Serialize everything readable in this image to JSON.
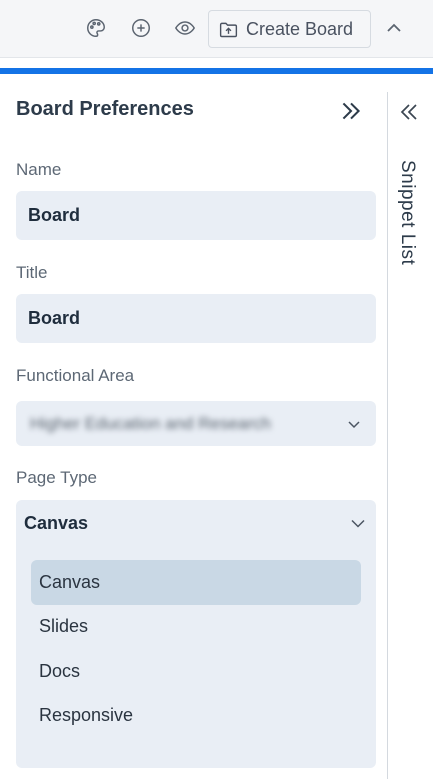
{
  "toolbar": {
    "icons": [
      "palette-icon",
      "add-circle-icon",
      "eye-icon"
    ],
    "create_board_label": "Create Board"
  },
  "panel": {
    "title": "Board Preferences",
    "name_label": "Name",
    "name_value": "Board",
    "title_label": "Title",
    "title_value": "Board",
    "functional_area_label": "Functional Area",
    "functional_area_value": "Higher Education and Research",
    "page_type_label": "Page Type",
    "page_type_value": "Canvas",
    "page_type_options": [
      "Canvas",
      "Slides",
      "Docs",
      "Responsive"
    ]
  },
  "sidebar": {
    "snippet_list_label": "Snippet List"
  },
  "colors": {
    "accent": "#1473e6",
    "field_bg": "#e9eef5",
    "selected_option_bg": "#c9d8e5"
  }
}
